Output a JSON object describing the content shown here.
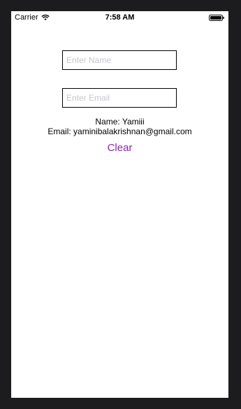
{
  "status_bar": {
    "carrier": "Carrier",
    "time": "7:58 AM",
    "icons": [
      "wifi-icon",
      "battery-icon"
    ]
  },
  "form": {
    "name_placeholder": "Enter Name",
    "name_value": "",
    "email_placeholder": "Enter Email",
    "email_value": ""
  },
  "output": {
    "name_line": "Name: Yamiii",
    "email_line": "Email: yaminibalakrishnan@gmail.com"
  },
  "actions": {
    "clear_label": "Clear"
  },
  "colors": {
    "accent": "#8e24aa",
    "bezel": "#1c1c1e",
    "placeholder": "#c7c7cd"
  }
}
